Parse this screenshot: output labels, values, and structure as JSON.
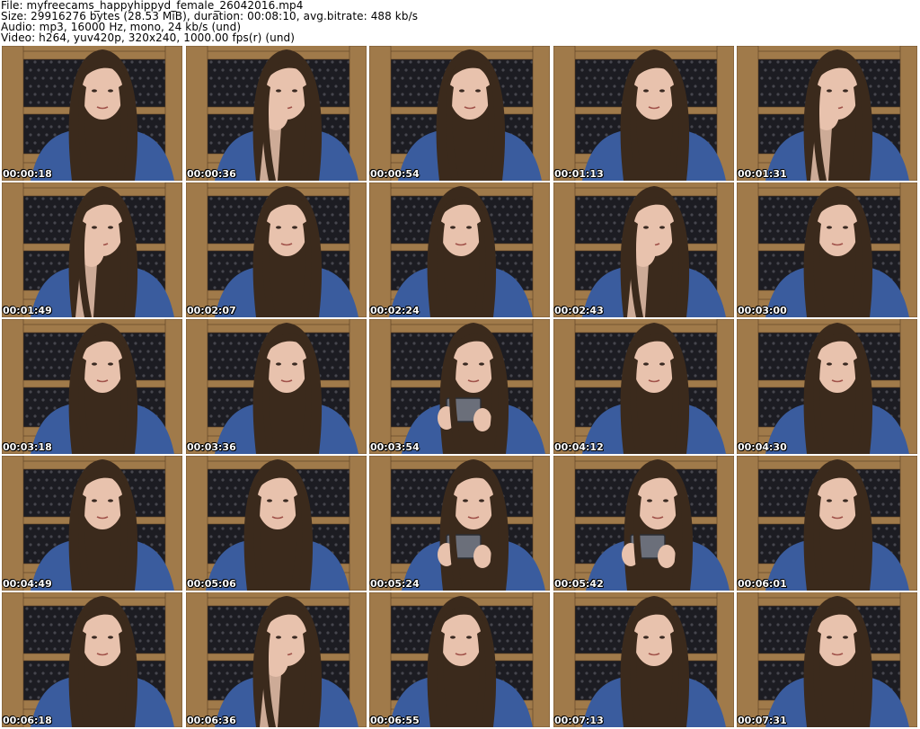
{
  "header": {
    "file_line": "File: myfreecams_happyhippyd_female_26042016.mp4",
    "size_line": "Size: 29916276 bytes (28.53 MiB), duration: 00:08:10, avg.bitrate: 488 kb/s",
    "audio_line": "Audio: mp3, 16000 Hz, mono, 24 kb/s (und)",
    "video_line": "Video: h264, yuv420p, 320x240, 1000.00 fps(r) (und)"
  },
  "colors": {
    "wood": "#a07a4a",
    "wood_dark": "#5a3f22",
    "backdrop": "#1c1c22",
    "backdrop_pattern": "#6a6a72",
    "jacket": "#3a5c9e",
    "hair": "#3b2a1c",
    "skin": "#e8c2ad",
    "timestamp": "#ffffff"
  },
  "thumbnails": [
    {
      "timestamp": "00:00:18",
      "pose": "center"
    },
    {
      "timestamp": "00:00:36",
      "pose": "hand-mouth"
    },
    {
      "timestamp": "00:00:54",
      "pose": "center"
    },
    {
      "timestamp": "00:01:13",
      "pose": "center"
    },
    {
      "timestamp": "00:01:31",
      "pose": "hand-mouth"
    },
    {
      "timestamp": "00:01:49",
      "pose": "hand-mouth"
    },
    {
      "timestamp": "00:02:07",
      "pose": "center"
    },
    {
      "timestamp": "00:02:24",
      "pose": "lean"
    },
    {
      "timestamp": "00:02:43",
      "pose": "hand-mouth"
    },
    {
      "timestamp": "00:03:00",
      "pose": "center"
    },
    {
      "timestamp": "00:03:18",
      "pose": "center"
    },
    {
      "timestamp": "00:03:36",
      "pose": "center"
    },
    {
      "timestamp": "00:03:54",
      "pose": "holding-case"
    },
    {
      "timestamp": "00:04:12",
      "pose": "center"
    },
    {
      "timestamp": "00:04:30",
      "pose": "center"
    },
    {
      "timestamp": "00:04:49",
      "pose": "center"
    },
    {
      "timestamp": "00:05:06",
      "pose": "lean"
    },
    {
      "timestamp": "00:05:24",
      "pose": "holding-case"
    },
    {
      "timestamp": "00:05:42",
      "pose": "holding-case"
    },
    {
      "timestamp": "00:06:01",
      "pose": "center"
    },
    {
      "timestamp": "00:06:18",
      "pose": "center"
    },
    {
      "timestamp": "00:06:36",
      "pose": "hand-mouth"
    },
    {
      "timestamp": "00:06:55",
      "pose": "lean"
    },
    {
      "timestamp": "00:07:13",
      "pose": "center"
    },
    {
      "timestamp": "00:07:31",
      "pose": "center"
    }
  ]
}
